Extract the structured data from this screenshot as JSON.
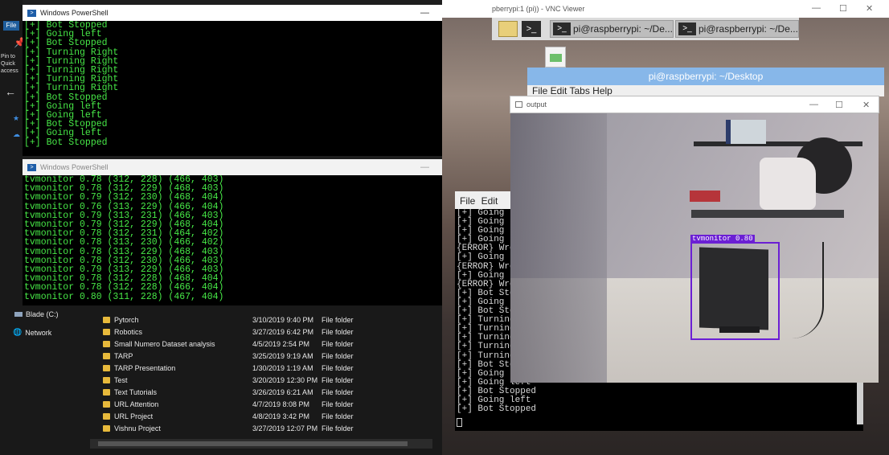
{
  "explorer": {
    "file_tab": "File",
    "pin_label": "Pin to Quick access",
    "nav": [
      {
        "label": "Blade (C:)"
      },
      {
        "label": "Network"
      }
    ],
    "rows": [
      {
        "name": "Pytorch",
        "date": "3/10/2019 9:40 PM",
        "type": "File folder"
      },
      {
        "name": "Robotics",
        "date": "3/27/2019 6:42 PM",
        "type": "File folder"
      },
      {
        "name": "Small Numero Dataset analysis",
        "date": "4/5/2019 2:54 PM",
        "type": "File folder"
      },
      {
        "name": "TARP",
        "date": "3/25/2019 9:19 AM",
        "type": "File folder"
      },
      {
        "name": "TARP Presentation",
        "date": "1/30/2019 1:19 AM",
        "type": "File folder"
      },
      {
        "name": "Test",
        "date": "3/20/2019 12:30 PM",
        "type": "File folder"
      },
      {
        "name": "Text Tutorials",
        "date": "3/26/2019 6:21 AM",
        "type": "File folder"
      },
      {
        "name": "URL Attention",
        "date": "4/7/2019 8:08 PM",
        "type": "File folder"
      },
      {
        "name": "URL Project",
        "date": "4/8/2019 3:42 PM",
        "type": "File folder"
      },
      {
        "name": "Vishnu Project",
        "date": "3/27/2019 12:07 PM",
        "type": "File folder"
      }
    ]
  },
  "ps1": {
    "title": "Windows PowerShell",
    "lines": [
      "[+] Bot Stopped",
      "[+] Going left",
      "[+] Bot Stopped",
      "[+] Turning Right",
      "[+] Turning Right",
      "[+] Turning Right",
      "[+] Turning Right",
      "[+] Turning Right",
      "[+] Bot Stopped",
      "[+] Going left",
      "[+] Going left",
      "[+] Bot Stopped",
      "[+] Going left",
      "[+] Bot Stopped"
    ]
  },
  "ps2": {
    "title": "Windows PowerShell",
    "lines": [
      "tvmonitor 0.78 (312, 228) (466, 403)",
      "tvmonitor 0.78 (312, 229) (468, 403)",
      "tvmonitor 0.79 (312, 230) (468, 404)",
      "tvmonitor 0.76 (313, 229) (466, 404)",
      "tvmonitor 0.79 (313, 231) (466, 403)",
      "tvmonitor 0.79 (312, 229) (468, 404)",
      "tvmonitor 0.78 (312, 231) (464, 402)",
      "tvmonitor 0.78 (313, 230) (466, 402)",
      "tvmonitor 0.78 (313, 229) (468, 403)",
      "tvmonitor 0.78 (312, 230) (466, 403)",
      "tvmonitor 0.79 (313, 229) (466, 403)",
      "tvmonitor 0.78 (312, 228) (468, 404)",
      "tvmonitor 0.78 (312, 228) (466, 404)",
      "tvmonitor 0.80 (311, 228) (467, 404)"
    ]
  },
  "vnc": {
    "title": "pberrypi:1 (pi)) - VNC Viewer",
    "taskbar_items": [
      "pi@raspberrypi: ~/De...",
      "pi@raspberrypi: ~/De..."
    ],
    "terminal_title": "pi@raspberrypi: ~/Desktop",
    "terminal_menu": "File  Edit  Tabs  Help",
    "terminal2_menu": "File Edit",
    "terminal2_lines": [
      "[+] Going l",
      "[+] Going l",
      "[+] Going l",
      "[+] Going l",
      "{ERROR} Wro",
      "[+] Going l",
      "{ERROR} Wro",
      "[+] Going l",
      "{ERROR} Wro",
      "[+] Bot Sto",
      "[+] Going l",
      "[+] Bot Sto",
      "[+] Turning",
      "[+] Turning",
      "[+] Turning",
      "[+] Turning",
      "[+] Turning",
      "[+] Bot Sto",
      "[+] Going l",
      "[+] Going left",
      "[+] Bot Stopped",
      "[+] Going left",
      "[+] Bot Stopped"
    ],
    "output_title": "output",
    "detection_label": "tvmonitor 0.80"
  },
  "controls": {
    "minimize": "—",
    "maximize": "☐",
    "close": "✕"
  }
}
